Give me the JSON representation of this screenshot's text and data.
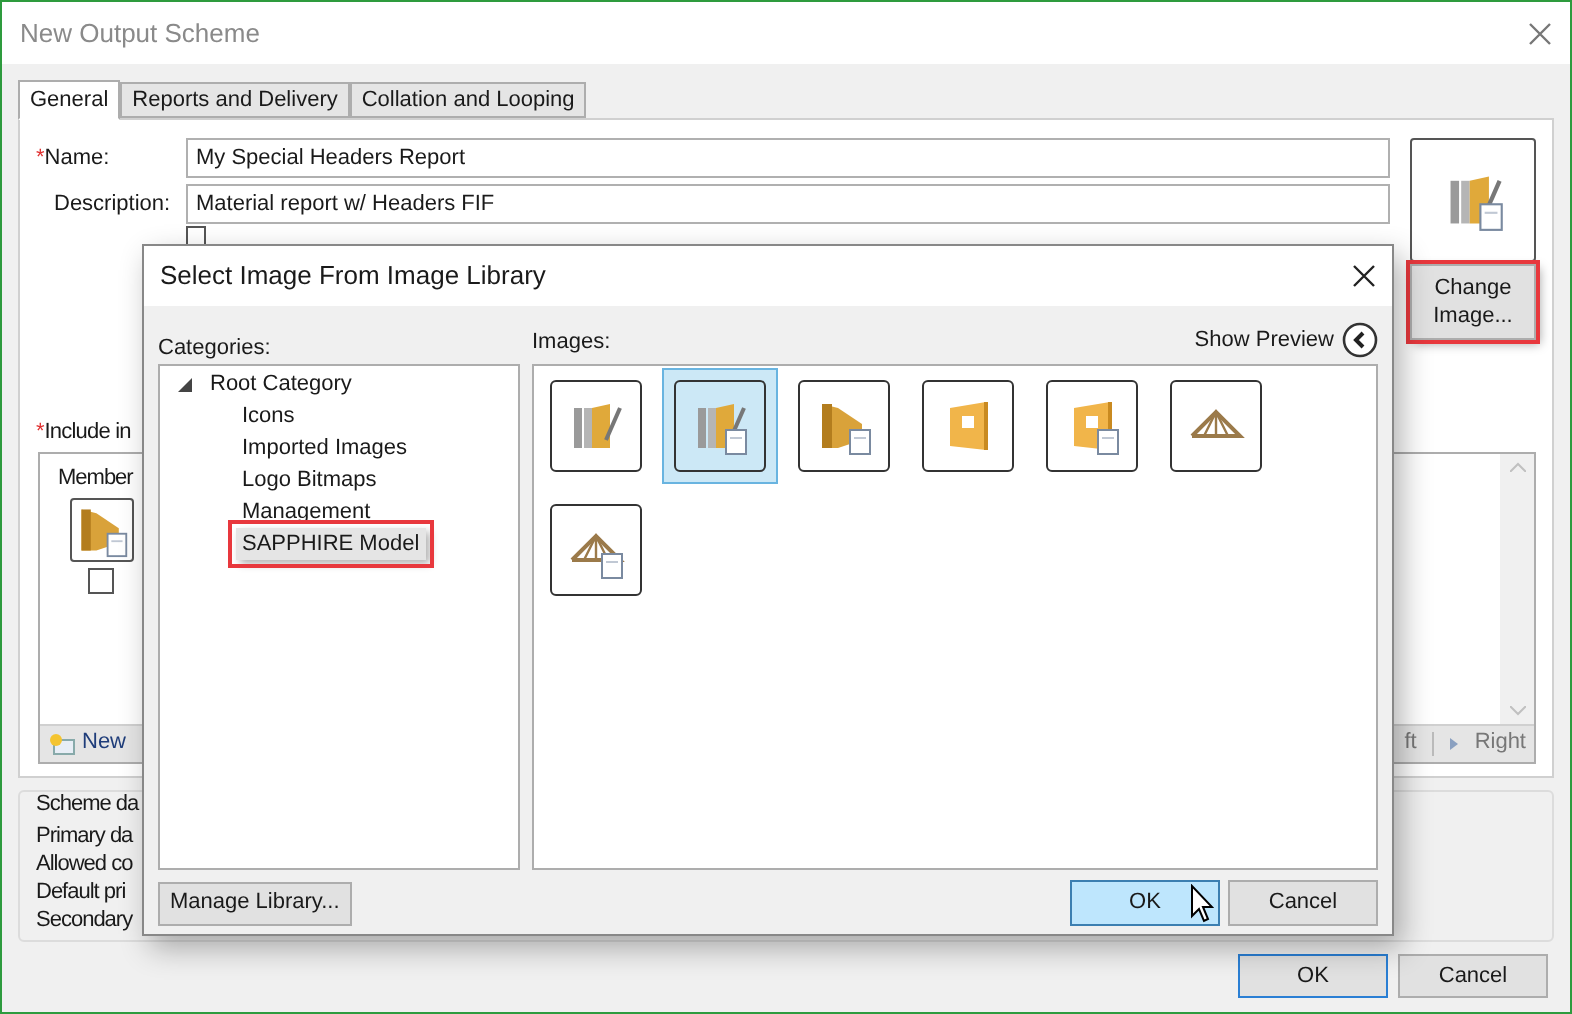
{
  "window": {
    "title": "New Output Scheme"
  },
  "tabs": [
    {
      "label": "General",
      "selected": true
    },
    {
      "label": "Reports and Delivery",
      "selected": false
    },
    {
      "label": "Collation and Looping",
      "selected": false
    }
  ],
  "general": {
    "name": {
      "label": "Name:",
      "required_mark": "*",
      "value": "My Special Headers Report"
    },
    "description": {
      "label": "Description:",
      "value": "Material report w/ Headers FIF"
    },
    "watermark": {
      "checked": false
    },
    "image_button": {
      "label": "Change Image...",
      "callout": true
    },
    "include": {
      "label": "Include in",
      "required_mark": "*"
    },
    "members": {
      "header": "Member",
      "checked": false,
      "new_button": "New",
      "left_button": "ft",
      "right_button": "Right"
    },
    "scheme": {
      "title": "Scheme da",
      "lines": [
        "Primary da",
        "Allowed co",
        "Default pri",
        "Secondary"
      ]
    }
  },
  "dialog": {
    "title": "Select Image From Image Library",
    "categories_label": "Categories:",
    "tree": [
      {
        "label": "Root Category",
        "expanded": true,
        "selected": false,
        "callout": false,
        "children": [
          {
            "label": "Icons",
            "selected": false,
            "callout": false
          },
          {
            "label": "Imported Images",
            "selected": false,
            "callout": false
          },
          {
            "label": "Logo Bitmaps",
            "selected": false,
            "callout": false
          },
          {
            "label": "Management",
            "selected": false,
            "callout": false
          },
          {
            "label": "SAPPHIRE Model",
            "selected": true,
            "callout": true
          }
        ]
      }
    ],
    "images_label": "Images:",
    "show_preview": "Show Preview",
    "images": [
      {
        "kind": "studs",
        "selected": false
      },
      {
        "kind": "studs-doc",
        "selected": true
      },
      {
        "kind": "beam-doc",
        "selected": false
      },
      {
        "kind": "panel",
        "selected": false
      },
      {
        "kind": "panel-doc",
        "selected": false
      },
      {
        "kind": "truss",
        "selected": false
      },
      {
        "kind": "truss-doc",
        "selected": false
      }
    ],
    "manage_button": "Manage Library...",
    "buttons": [
      {
        "label": "OK",
        "hovered": true
      },
      {
        "label": "Cancel",
        "hovered": false
      }
    ]
  },
  "buttons": [
    {
      "label": "OK",
      "default": true
    },
    {
      "label": "Cancel",
      "default": false
    }
  ]
}
